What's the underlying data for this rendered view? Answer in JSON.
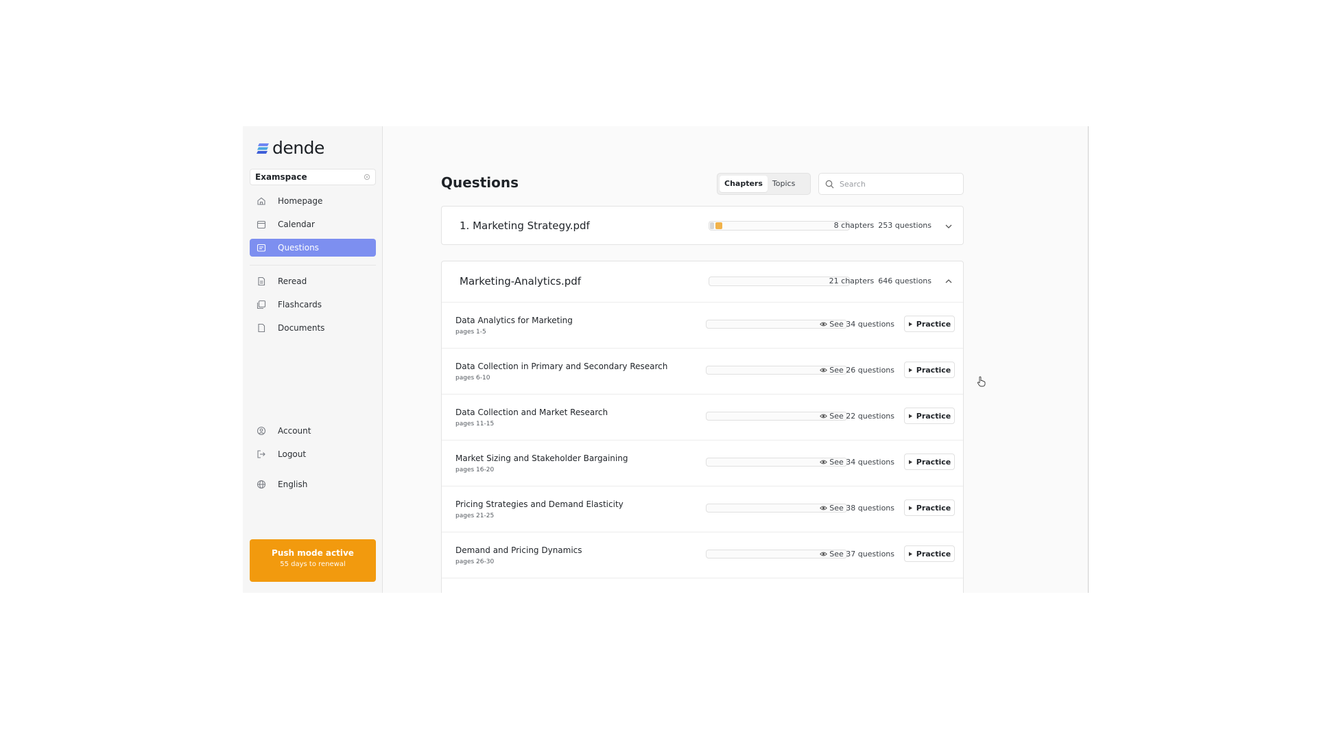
{
  "brand": {
    "name": "dende",
    "accent": "#7d8ff0",
    "push_color": "#f29a0e"
  },
  "workspace": {
    "label": "Examspace"
  },
  "sidebar": {
    "items": [
      {
        "label": "Homepage",
        "icon": "home-icon"
      },
      {
        "label": "Calendar",
        "icon": "calendar-icon"
      },
      {
        "label": "Questions",
        "icon": "questions-icon",
        "active": true
      },
      {
        "label": "Reread",
        "icon": "document-icon"
      },
      {
        "label": "Flashcards",
        "icon": "flashcards-icon"
      },
      {
        "label": "Documents",
        "icon": "file-icon"
      },
      {
        "label": "Account",
        "icon": "user-circle-icon"
      },
      {
        "label": "Logout",
        "icon": "logout-icon"
      },
      {
        "label": "English",
        "icon": "globe-icon"
      }
    ],
    "push": {
      "title": "Push mode active",
      "subtitle": "55 days to renewal"
    }
  },
  "main": {
    "title": "Questions",
    "tabs": [
      {
        "label": "Chapters",
        "selected": true
      },
      {
        "label": "Topics",
        "selected": false
      }
    ],
    "search": {
      "placeholder": "Search",
      "value": ""
    },
    "documents": [
      {
        "title": "1. Marketing Strategy.pdf",
        "chapters": "8 chapters",
        "questions": "253 questions",
        "expanded": false
      },
      {
        "title": "Marketing-Analytics.pdf",
        "chapters": "21 chapters",
        "questions": "646 questions",
        "expanded": true,
        "chapter_list": [
          {
            "title": "Data Analytics for Marketing",
            "pages": "pages 1-5",
            "see": "See 34 questions",
            "action": "Practice"
          },
          {
            "title": "Data Collection in Primary and Secondary Research",
            "pages": "pages 6-10",
            "see": "See 26 questions",
            "action": "Practice"
          },
          {
            "title": "Data Collection and Market Research",
            "pages": "pages 11-15",
            "see": "See 22 questions",
            "action": "Practice"
          },
          {
            "title": "Market Sizing and Stakeholder Bargaining",
            "pages": "pages 16-20",
            "see": "See 34 questions",
            "action": "Practice"
          },
          {
            "title": "Pricing Strategies and Demand Elasticity",
            "pages": "pages 21-25",
            "see": "See 38 questions",
            "action": "Practice"
          },
          {
            "title": "Demand and Pricing Dynamics",
            "pages": "pages 26-30",
            "see": "See 37 questions",
            "action": "Practice"
          }
        ]
      }
    ]
  }
}
